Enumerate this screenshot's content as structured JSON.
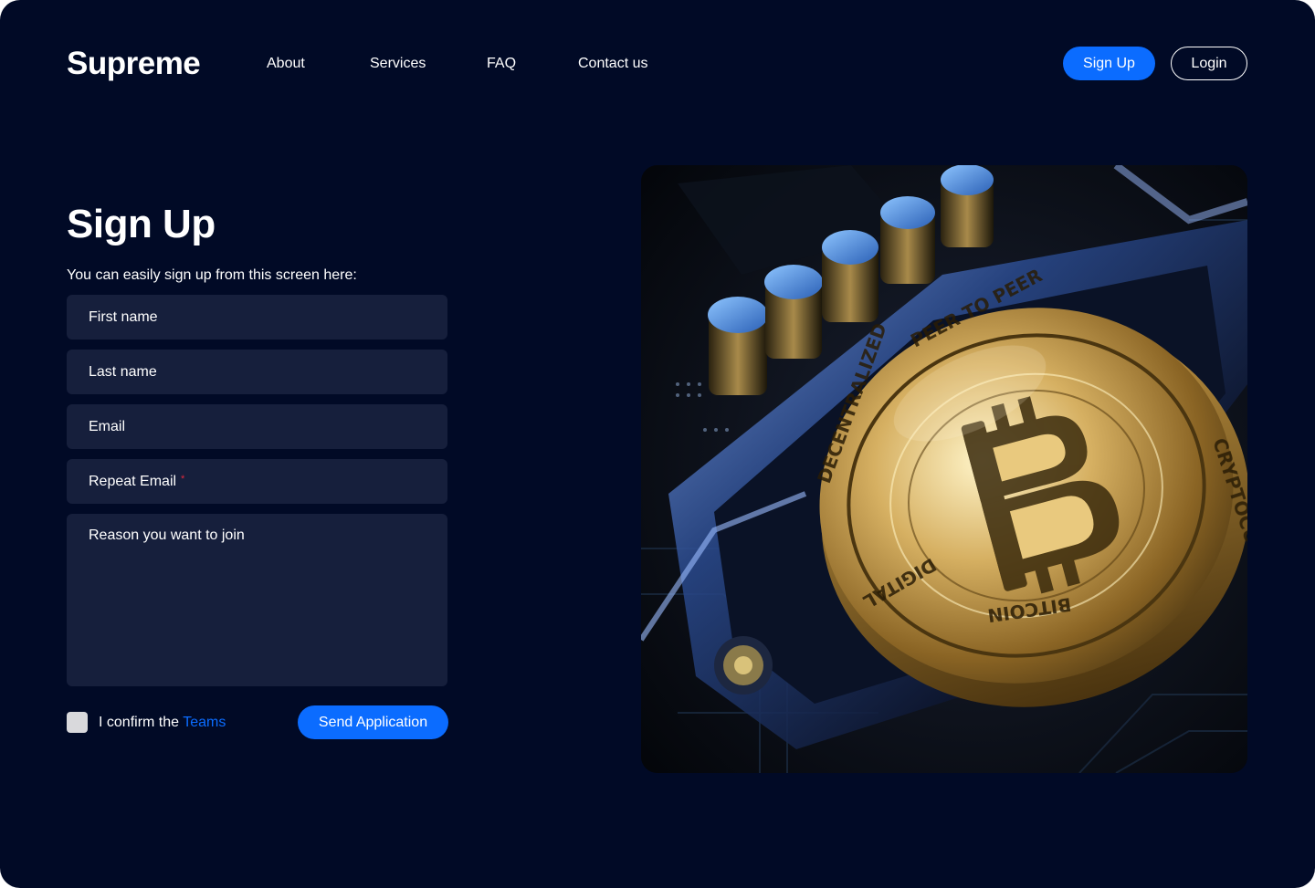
{
  "brand": {
    "name": "Supreme"
  },
  "nav": {
    "links": [
      "About",
      "Services",
      "FAQ",
      "Contact us"
    ],
    "signup_label": "Sign Up",
    "login_label": "Login"
  },
  "form": {
    "title": "Sign Up",
    "subtitle": "You can easily sign up from this screen here:",
    "fields": {
      "first_name": "First name",
      "last_name": "Last name",
      "email": "Email",
      "repeat_email": "Repeat Email",
      "repeat_email_required_mark": "*",
      "reason": "Reason you want to join"
    },
    "confirm_text": "I confirm the",
    "confirm_link": "Teams",
    "submit_label": "Send Application"
  },
  "image": {
    "icon": "bitcoin-coin-photo",
    "coin_text_top": "PEER TO PEER",
    "coin_text_left": "DECENTRALIZED",
    "coin_text_right": "CRYPTOCURRENCY",
    "coin_text_bottom": "BITCOIN",
    "coin_text_lower_left": "DIGITAL"
  },
  "colors": {
    "background": "#010A26",
    "field": "#161F3C",
    "accent": "#0B6CFF",
    "required": "#E0283C",
    "checkbox": "#D9D9DC"
  }
}
